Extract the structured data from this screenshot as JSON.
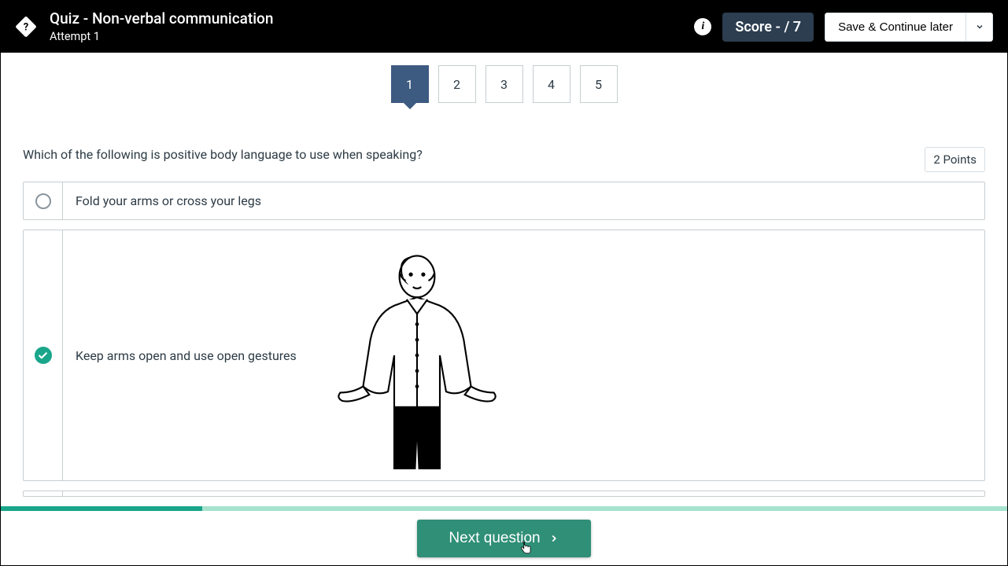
{
  "header": {
    "title": "Quiz - Non-verbal communication",
    "subtitle": "Attempt 1",
    "score_label": "Score - / 7",
    "save_label": "Save & Continue later"
  },
  "nav": {
    "items": [
      "1",
      "2",
      "3",
      "4",
      "5"
    ],
    "active_index": 0
  },
  "question": {
    "prompt": "Which of the following is positive body language to use when speaking?",
    "points_label": "2 Points",
    "options": [
      {
        "label": "Fold your arms or cross your legs",
        "selected": false,
        "has_image": false
      },
      {
        "label": "Keep arms open and use open gestures",
        "selected": true,
        "has_image": true
      }
    ]
  },
  "progress": {
    "percent": 20
  },
  "footer": {
    "next_label": "Next question"
  },
  "colors": {
    "accent": "#3d5a80",
    "correct": "#1aa68a",
    "next": "#2f8f77"
  }
}
